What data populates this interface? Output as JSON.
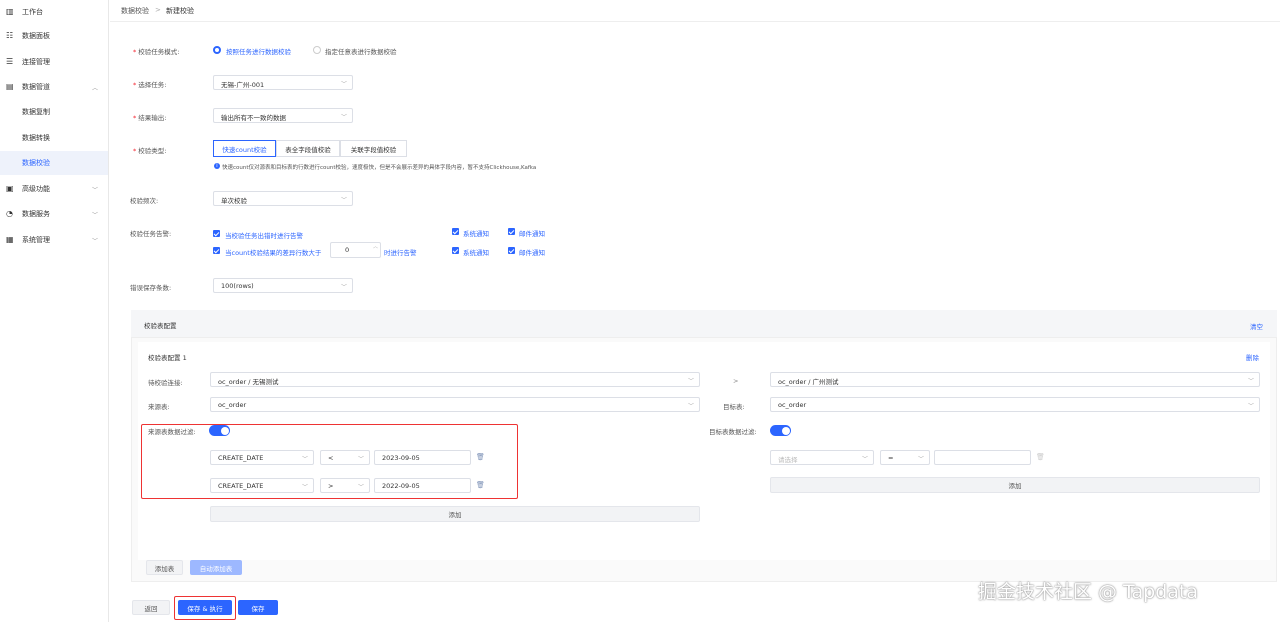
{
  "sidebar": {
    "items": [
      {
        "label": "工作台",
        "icon": "dashboard-icon"
      },
      {
        "label": "数据面板",
        "icon": "panel-icon"
      },
      {
        "label": "连接管理",
        "icon": "connection-icon"
      },
      {
        "label": "数据管道",
        "icon": "pipeline-icon"
      },
      {
        "label": "数据复制"
      },
      {
        "label": "数据转换"
      },
      {
        "label": "数据校验"
      },
      {
        "label": "高级功能",
        "icon": "advanced-icon"
      },
      {
        "label": "数据服务",
        "icon": "service-icon"
      },
      {
        "label": "系统管理",
        "icon": "system-icon"
      }
    ]
  },
  "breadcrumb": {
    "parent": "数据校验",
    "separator": ">",
    "current": "新建校验"
  },
  "form": {
    "mode_label": "校验任务模式:",
    "mode_option1": "按照任务进行数据校验",
    "mode_option2": "指定任意表进行数据校验",
    "task_label": "选择任务:",
    "task_value": "无锡-广州-001",
    "output_label": "结果输出:",
    "output_value": "输出所有不一致的数据",
    "type_label": "校验类型:",
    "type_options": [
      "快速count校验",
      "表全字段值校验",
      "关联字段值校验"
    ],
    "type_hint": "快速count仅对源表和目标表的行数进行count校验，速度极快，但是不会展示差异的具体字段内容，暂不支持Clickhouse,Kafka",
    "freq_label": "校验频次:",
    "freq_value": "单次校验",
    "alarm_label": "校验任务告警:",
    "alarm1": "当校验任务出错时进行告警",
    "alarm2_pre": "当count校验结果的差异行数大于",
    "alarm2_value": "0",
    "alarm2_post": "时进行告警",
    "notify_system": "系统通知",
    "notify_email": "邮件通知",
    "error_label": "错误保存条数:",
    "error_value": "100(rows)"
  },
  "config": {
    "title": "校验表配置",
    "clear": "清空",
    "item_title": "校验表配置 1",
    "delete": "删除",
    "conn_label": "待校验连接:",
    "source_conn": "oc_order / 无锡测试",
    "arrow": ">",
    "target_conn": "oc_order / 广州测试",
    "source_table_label": "来源表:",
    "source_table": "oc_order",
    "target_table_label": "目标表:",
    "target_table": "oc_order",
    "source_filter_label": "来源表数据过滤:",
    "target_filter_label": "目标表数据过滤:",
    "filters": [
      {
        "field": "CREATE_DATE",
        "op": "<",
        "value": "2023-09-05"
      },
      {
        "field": "CREATE_DATE",
        "op": ">",
        "value": "2022-09-05"
      }
    ],
    "target_field_placeholder": "请选择",
    "target_op": "=",
    "add": "添加",
    "add_table": "添加表",
    "auto_add_table": "自动添加表"
  },
  "footer": {
    "back": "返回",
    "save_run": "保存 & 执行",
    "save": "保存"
  },
  "watermark": "掘金技术社区 @ Tapdata"
}
